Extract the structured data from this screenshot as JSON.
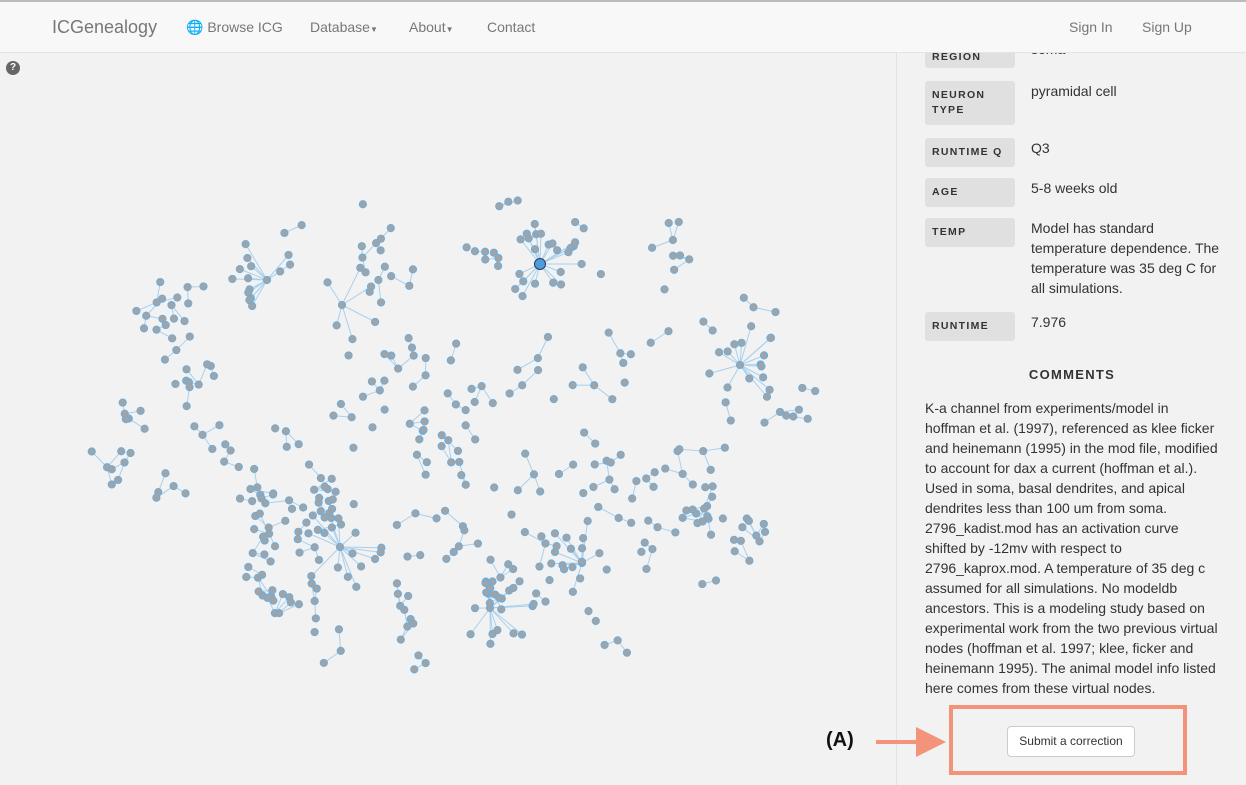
{
  "nav": {
    "brand": "ICGenealogy",
    "browse": "Browse ICG",
    "database": "Database",
    "about": "About",
    "contact": "Contact",
    "signin": "Sign In",
    "signup": "Sign Up"
  },
  "help_icon": "?",
  "colors": {
    "node": "#a3a3a3",
    "node_stroke": "#6aaee0",
    "edge": "#a8d0ee",
    "highlight": "#4a9fd8",
    "annotation": "#f2937a"
  },
  "details": [
    {
      "label": "REGION",
      "value": "soma"
    },
    {
      "label": "NEURON TYPE",
      "value": "pyramidal cell"
    },
    {
      "label": "RUNTIME Q",
      "value": "Q3"
    },
    {
      "label": "AGE",
      "value": "5-8 weeks old"
    },
    {
      "label": "TEMP",
      "value": "Model has standard temperature dependence. The temperature was 35 deg C for all simulations."
    },
    {
      "label": "RUNTIME",
      "value": "7.976"
    }
  ],
  "comments_title": "COMMENTS",
  "comments": "K-a channel from experiments/model in hoffman et al. (1997), referenced as klee ficker and heinemann (1995) in the mod file, modified to account for dax a current (hoffman et al.). Used in soma, basal dendrites, and apical dendrites less than 100 um from soma. 2796_kadist.mod has an activation curve shifted by -12mv with respect to 2796_kaprox.mod. A temperature of 35 deg c assumed for all simulations. No modeldb ancestors. This is a modeling study based on experimental work from the two previous virtual nodes (hoffman et al. 1997; klee, ficker and heinemann 1995). The animal model info listed here comes from these virtual nodes.",
  "submit_label": "Submit a correction",
  "annotation_label": "(A)"
}
